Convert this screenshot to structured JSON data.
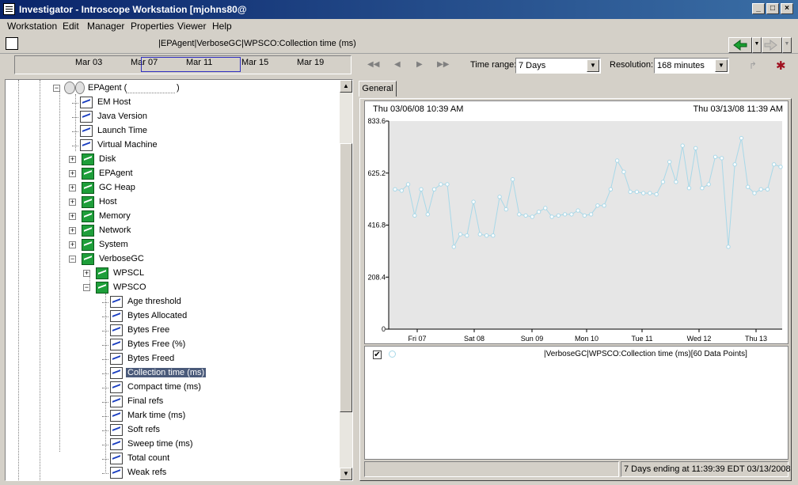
{
  "window": {
    "title": "Investigator - Introscope Workstation [mjohns80@"
  },
  "menu": [
    {
      "label": "Workstation"
    },
    {
      "label": "Edit"
    },
    {
      "label": "Manager"
    },
    {
      "label": "Properties"
    },
    {
      "label": "Viewer"
    },
    {
      "label": "Help"
    }
  ],
  "path": {
    "text": "|EPAgent|VerboseGC|WPSCO:Collection time (ms)"
  },
  "timeline": {
    "ticks": [
      "Mar 03",
      "Mar 07",
      "Mar 11",
      "Mar 15",
      "Mar 19"
    ]
  },
  "controls": {
    "time_range_label": "Time range:",
    "time_range_value": "7 Days",
    "resolution_label": "Resolution:",
    "resolution_value": "168 minutes"
  },
  "tree": {
    "root_label": "EPAgent (",
    "items": [
      {
        "label": "EM Host"
      },
      {
        "label": "Java Version"
      },
      {
        "label": "Launch Time"
      },
      {
        "label": "Virtual Machine"
      },
      {
        "label": "Disk"
      },
      {
        "label": "EPAgent"
      },
      {
        "label": "GC Heap"
      },
      {
        "label": "Host"
      },
      {
        "label": "Memory"
      },
      {
        "label": "Network"
      },
      {
        "label": "System"
      },
      {
        "label": "VerboseGC"
      },
      {
        "label": "WPSCL"
      },
      {
        "label": "WPSCO"
      },
      {
        "label": "Age threshold"
      },
      {
        "label": "Bytes Allocated"
      },
      {
        "label": "Bytes Free"
      },
      {
        "label": "Bytes Free (%)"
      },
      {
        "label": "Bytes Freed"
      },
      {
        "label": "Collection time (ms)"
      },
      {
        "label": "Compact time (ms)"
      },
      {
        "label": "Final refs"
      },
      {
        "label": "Mark time (ms)"
      },
      {
        "label": "Soft refs"
      },
      {
        "label": "Sweep time (ms)"
      },
      {
        "label": "Total count"
      },
      {
        "label": "Weak refs"
      }
    ]
  },
  "tab": {
    "label": "General"
  },
  "graph": {
    "start_label": "Thu 03/06/08 10:39 AM",
    "end_label": "Thu 03/13/08 11:39 AM",
    "legend_text": "|VerboseGC|WPSCO:Collection time (ms)[60 Data Points]",
    "status_text": "7 Days ending at 11:39:39 EDT 03/13/2008"
  },
  "chart_data": {
    "type": "line",
    "title": "",
    "xlabel": "",
    "ylabel": "",
    "ylim": [
      0,
      833.6
    ],
    "yticks": [
      "0",
      "208.4",
      "416.8",
      "625.2",
      "833.6"
    ],
    "xticks": [
      "Fri 07",
      "Sat 08",
      "Sun 09",
      "Mon 10",
      "Tue 11",
      "Wed 12",
      "Thu 13"
    ],
    "grid": false,
    "color": "#a8d8e8",
    "series": [
      {
        "values": [
          560,
          555,
          580,
          455,
          560,
          460,
          560,
          580,
          580,
          330,
          380,
          375,
          510,
          380,
          375,
          375,
          530,
          480,
          600,
          460,
          455,
          450,
          470,
          485,
          450,
          455,
          460,
          460,
          475,
          455,
          460,
          495,
          495,
          560,
          675,
          630,
          550,
          550,
          545,
          545,
          540,
          590,
          670,
          590,
          735,
          565,
          725,
          565,
          580,
          690,
          685,
          330,
          660,
          765,
          570,
          545,
          560,
          560,
          660,
          650
        ]
      }
    ]
  }
}
